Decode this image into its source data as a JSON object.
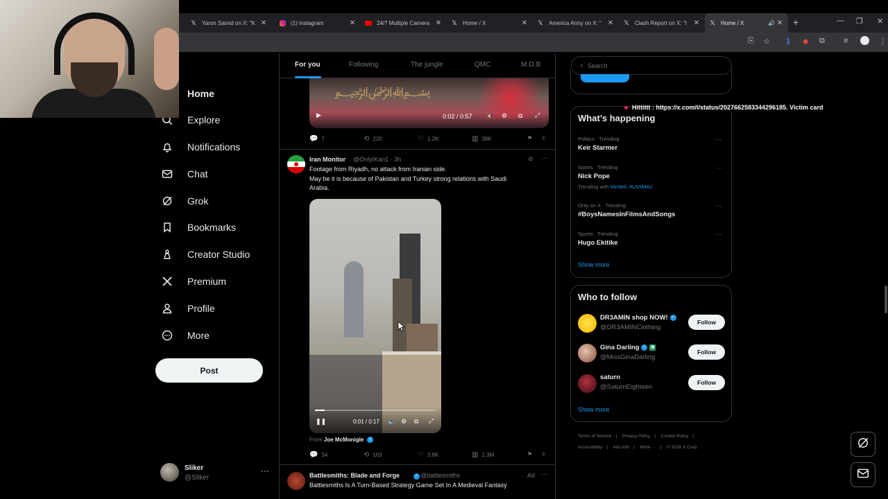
{
  "browser": {
    "tabs": [
      {
        "label": "Yaron Samid on X: \"K",
        "icon": "x-logo-icon"
      },
      {
        "label": "(1) Instagram",
        "icon": "instagram-icon"
      },
      {
        "label": "24/7 Multiple Camera",
        "icon": "youtube-icon"
      },
      {
        "label": "Home / X",
        "icon": "x-logo-icon"
      },
      {
        "label": "America Army on X: \"",
        "icon": "x-logo-icon"
      },
      {
        "label": "Clash Report on X: \"I",
        "icon": "x-logo-icon"
      },
      {
        "label": "Home / X",
        "icon": "x-logo-icon",
        "active": true
      }
    ],
    "accent": "#1d9bf0"
  },
  "sidebar": {
    "items": [
      {
        "label": "Home",
        "icon": "home-icon"
      },
      {
        "label": "Explore",
        "icon": "search-icon"
      },
      {
        "label": "Notifications",
        "icon": "bell-icon"
      },
      {
        "label": "Chat",
        "icon": "mail-icon"
      },
      {
        "label": "Grok",
        "icon": "grok-icon"
      },
      {
        "label": "Bookmarks",
        "icon": "bookmark-icon"
      },
      {
        "label": "Creator Studio",
        "icon": "creator-studio-icon"
      },
      {
        "label": "Premium",
        "icon": "x-logo-icon"
      },
      {
        "label": "Profile",
        "icon": "person-icon"
      },
      {
        "label": "More",
        "icon": "more-circle-icon"
      }
    ],
    "post_label": "Post",
    "account": {
      "name": "Sliker",
      "handle": "@Sliker",
      "more": "···"
    }
  },
  "feed": {
    "tabs": [
      "For you",
      "Following",
      "The jungle",
      "QMC",
      "M.O.B"
    ],
    "tweet1": {
      "video_time": "0:02 / 0:57",
      "stats": {
        "replies": "7",
        "reposts": "220",
        "likes": "1.2K",
        "views": "38K"
      }
    },
    "tweet2": {
      "name": "Iran Monitor",
      "handle": "@OnlyIKan1 · 3h",
      "text_line1": "Footage from Riyadh, no attack from Iranian side.",
      "text_line2": "May be it is because of Pakistan and Turkey strong relations with Saudi",
      "text_line3": "Arabia.",
      "video_time": "0:01 / 0:17",
      "from_label": "From",
      "from_name": "Joe McMonigle",
      "stats": {
        "replies": "54",
        "reposts": "163",
        "likes": "3.6K",
        "views": "1.3M"
      }
    },
    "tweet3": {
      "name": "Battlesmiths: Blade and Forge",
      "handle": "@battlesmiths",
      "ad": "Ad",
      "text": "Battlesmiths Is A Turn-Based Strategy Game Set In A Medieval Fantasy"
    }
  },
  "right": {
    "search_placeholder": "Search",
    "happening": {
      "title": "What’s happening",
      "trends": [
        {
          "meta": "Politics · Trending",
          "name": "Keir Starmer"
        },
        {
          "meta": "Sports · Trending",
          "name": "Nick Pope",
          "extra_prefix": "Trending with",
          "extra_links": "McNeil, #LIVWHU"
        },
        {
          "meta": "Only on X · Trending",
          "name": "#BoysNamesInFilmsAndSongs"
        },
        {
          "meta": "Sports · Trending",
          "name": "Hugo Ekitike"
        }
      ],
      "show_more": "Show more"
    },
    "who_to_follow": {
      "title": "Who to follow",
      "users": [
        {
          "name": "DR3AMIN shop NOW!",
          "handle": "@DR3AMINClothing",
          "button": "Follow"
        },
        {
          "name": "Gina Darling",
          "handle": "@MissGinaDarling",
          "button": "Follow"
        },
        {
          "name": "saturn",
          "handle": "@SaturnEighteen",
          "button": "Follow"
        }
      ],
      "show_more": "Show more"
    },
    "footer": [
      "Terms of Service",
      "|",
      "Privacy Policy",
      "|",
      "Cookie Policy",
      "|",
      "Accessibility",
      "|",
      "Ads info",
      "|",
      "More ···",
      "|",
      "© 2026 X Corp."
    ]
  },
  "overlay_text": "Hittittt : https://x.com/i/status/2027662583344296185. Victim card"
}
